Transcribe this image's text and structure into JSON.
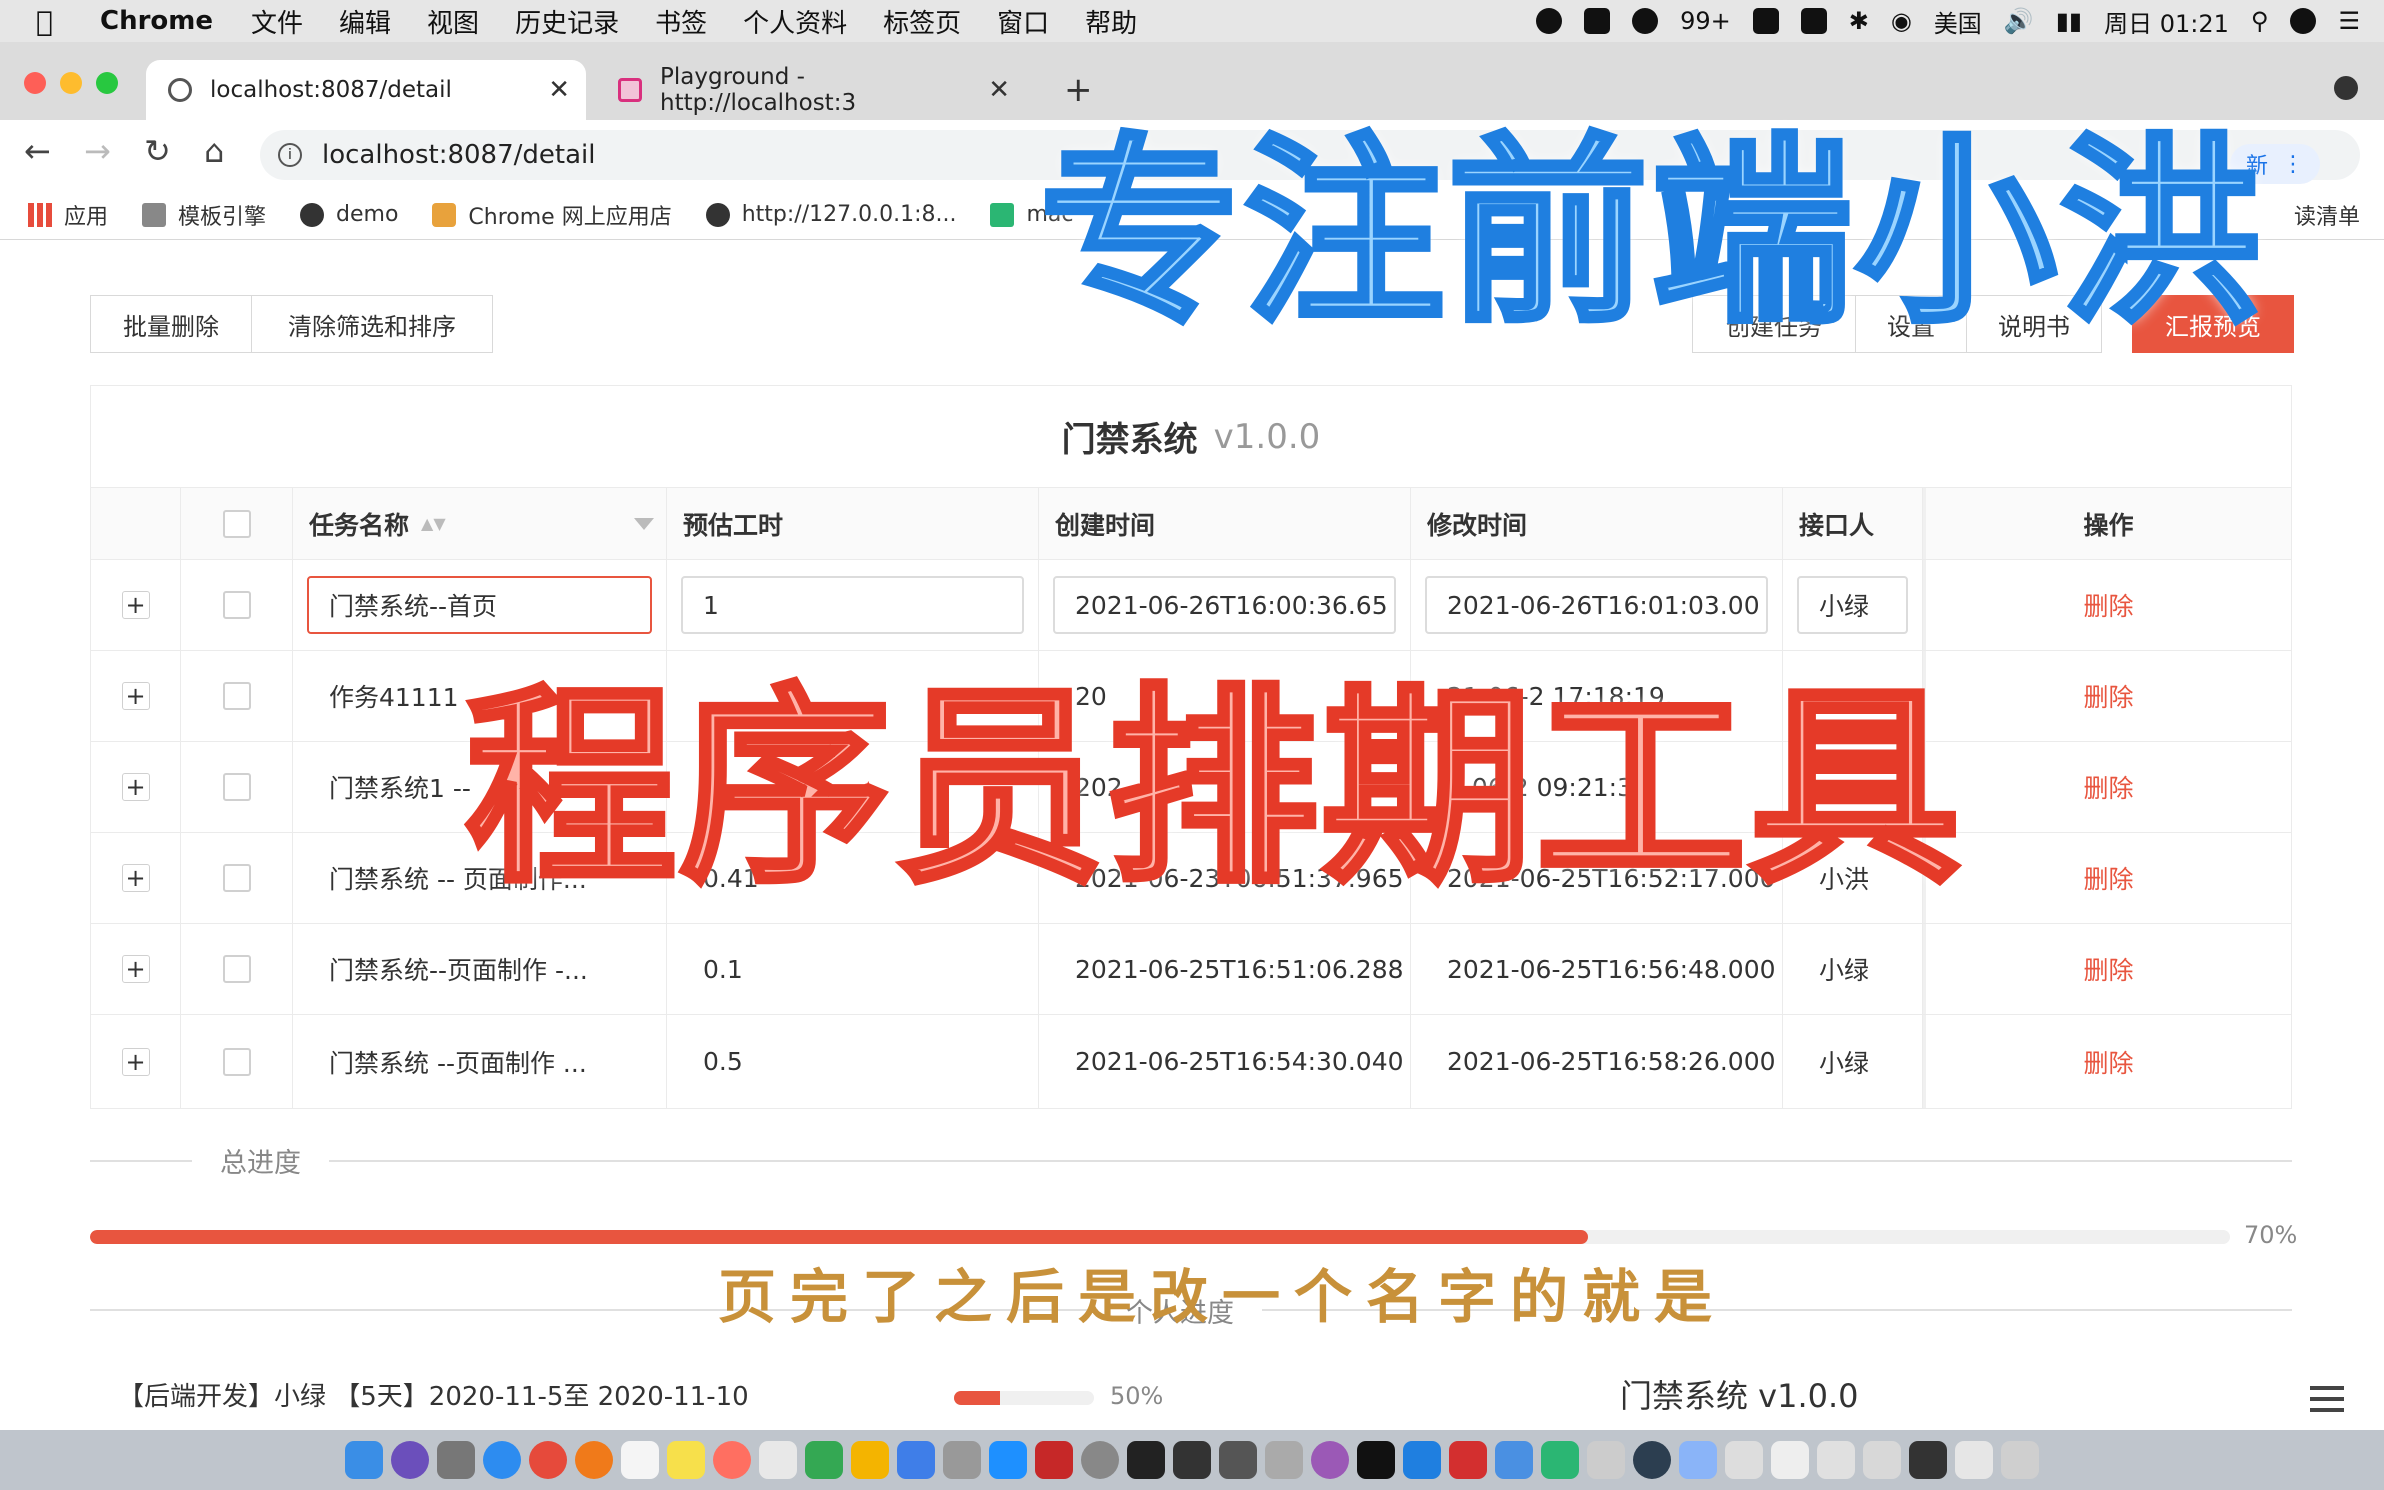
{
  "menubar": {
    "app": "Chrome",
    "items": [
      "文件",
      "编辑",
      "视图",
      "历史记录",
      "书签",
      "个人资料",
      "标签页",
      "窗口",
      "帮助"
    ],
    "notifications": "99+",
    "input_source": "美国",
    "clock": "周日 01:21"
  },
  "tabs": [
    {
      "title": "localhost:8087/detail"
    },
    {
      "title": "Playground - http://localhost:3"
    }
  ],
  "address_bar": {
    "url": "localhost:8087/detail",
    "update_label": "新"
  },
  "bookmarks": [
    "应用",
    "模板引擎",
    "demo",
    "Chrome 网上应用店",
    "http://127.0.0.1:8...",
    "mac",
    "读清单"
  ],
  "toolbar": {
    "batch_delete": "批量删除",
    "clear_filter": "清除筛选和排序",
    "create_task": "创建任务",
    "settings": "设置",
    "manual": "说明书",
    "report_preview": "汇报预览"
  },
  "table": {
    "title": "门禁系统",
    "version": "v1.0.0",
    "columns": [
      "任务名称",
      "预估工时",
      "创建时间",
      "修改时间",
      "接口人",
      "操作"
    ],
    "rows": [
      {
        "name": "门禁系统--首页",
        "hours": "1",
        "created": "2021-06-26T16:00:36.65",
        "modified": "2021-06-26T16:01:03.00",
        "owner": "小绿",
        "action": "删除"
      },
      {
        "name": "作务41111",
        "hours": "",
        "created": "20",
        "modified": "21-06-2  17:18:19.",
        "owner": "",
        "action": "删除"
      },
      {
        "name": "门禁系统1 --",
        "hours": "5",
        "created": "202",
        "modified": "1-06-2  09:21:3",
        "owner": "",
        "action": "删除"
      },
      {
        "name": "门禁系统 -- 页面制作...",
        "hours": "0.41",
        "created": "2021-06-23T06:51:37.965",
        "modified": "2021-06-25T16:52:17.000",
        "owner": "小洪",
        "action": "删除"
      },
      {
        "name": "门禁系统--页面制作 -...",
        "hours": "0.1",
        "created": "2021-06-25T16:51:06.288",
        "modified": "2021-06-25T16:56:48.000",
        "owner": "小绿",
        "action": "删除"
      },
      {
        "name": "门禁系统 --页面制作 ...",
        "hours": "0.5",
        "created": "2021-06-25T16:54:30.040",
        "modified": "2021-06-25T16:58:26.000",
        "owner": "小绿",
        "action": "删除"
      }
    ]
  },
  "progress": {
    "total_label": "总进度",
    "total_percent_text": "70%",
    "total_fraction": 0.7,
    "personal_label": "个人进度"
  },
  "bottom_item": {
    "text": "【后端开发】小绿 【5天】2020-11-5至 2020-11-10",
    "percent_text": "50%",
    "fraction": 0.33,
    "project": "门禁系统 v1.0.0"
  },
  "overlays": {
    "top_banner": "专注前端小洪",
    "center_banner": "程序员排期工具",
    "subtitle": "页完了之后是改一个名字的就是"
  },
  "colors": {
    "accent": "#e8553f",
    "overlay_blue": "#1f7fe0",
    "overlay_red": "#e53a28"
  }
}
